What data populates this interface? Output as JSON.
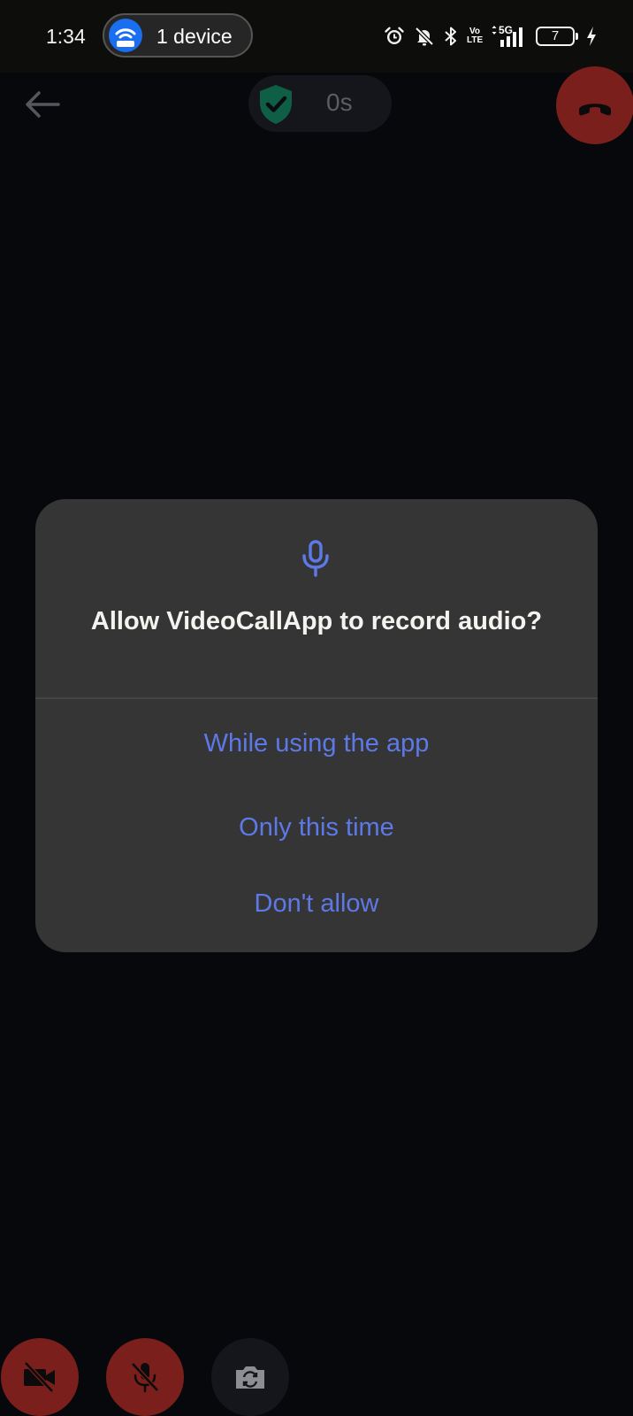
{
  "status_bar": {
    "time": "1:34",
    "hotspot_label": "1 device",
    "battery_level": "7",
    "volte_top": "Vo",
    "volte_bottom": "LTE",
    "network_label": "5G"
  },
  "call": {
    "duration": "0s"
  },
  "dialog": {
    "title": "Allow VideoCallApp to record audio?",
    "options": [
      "While using the app",
      "Only this time",
      "Don't allow"
    ]
  },
  "colors": {
    "accent": "#5d79e8",
    "dialog_background": "#353535",
    "end_call_red": "#7a1f1b",
    "hotspot_blue": "#1a6ff0"
  },
  "icons": {
    "status": [
      "alarm-icon",
      "mute-notifications-icon",
      "bluetooth-icon",
      "volte-icon",
      "signal-5g-icon",
      "battery-icon",
      "charging-icon"
    ],
    "call": [
      "back-arrow-icon",
      "shield-check-icon",
      "end-call-icon"
    ],
    "controls": [
      "video-off-icon",
      "mic-off-icon",
      "switch-camera-icon"
    ]
  }
}
